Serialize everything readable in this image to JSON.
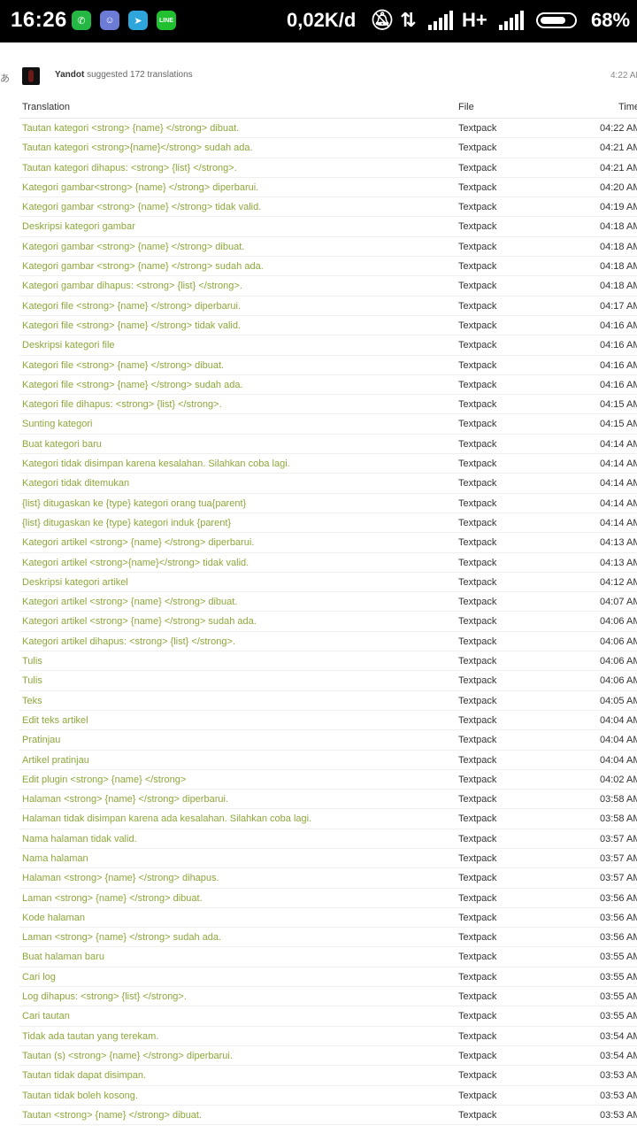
{
  "status_bar": {
    "time": "16:26",
    "apps": [
      "whatsapp-icon",
      "discord-icon",
      "telegram-icon",
      "line-icon"
    ],
    "net_speed": "0,02K/d",
    "network": "H+",
    "battery": "68%"
  },
  "activity": {
    "lang_glyph": "あ",
    "user": "Yandot",
    "action": " suggested 172 translations",
    "time": "4:22 AM"
  },
  "table": {
    "headers": {
      "translation": "Translation",
      "file": "File",
      "time": "Time"
    },
    "rows": [
      {
        "t": "Tautan kategori <strong> {name} </strong> dibuat.",
        "f": "Textpack",
        "time": "04:22 AM"
      },
      {
        "t": "Tautan kategori <strong>{name}</strong> sudah ada.",
        "f": "Textpack",
        "time": "04:21 AM"
      },
      {
        "t": "Tautan kategori dihapus: <strong> {list} </strong>.",
        "f": "Textpack",
        "time": "04:21 AM"
      },
      {
        "t": "Kategori gambar<strong> {name} </strong> diperbarui.",
        "f": "Textpack",
        "time": "04:20 AM"
      },
      {
        "t": "Kategori gambar <strong> {name} </strong> tidak valid.",
        "f": "Textpack",
        "time": "04:19 AM"
      },
      {
        "t": "Deskripsi kategori gambar",
        "f": "Textpack",
        "time": "04:18 AM"
      },
      {
        "t": "Kategori gambar <strong> {name} </strong> dibuat.",
        "f": "Textpack",
        "time": "04:18 AM"
      },
      {
        "t": "Kategori gambar <strong> {name} </strong> sudah ada.",
        "f": "Textpack",
        "time": "04:18 AM"
      },
      {
        "t": "Kategori gambar dihapus: <strong> {list} </strong>.",
        "f": "Textpack",
        "time": "04:18 AM"
      },
      {
        "t": "Kategori file <strong> {name} </strong> diperbarui.",
        "f": "Textpack",
        "time": "04:17 AM"
      },
      {
        "t": "Kategori file <strong> {name} </strong> tidak valid.",
        "f": "Textpack",
        "time": "04:16 AM"
      },
      {
        "t": "Deskripsi kategori file",
        "f": "Textpack",
        "time": "04:16 AM"
      },
      {
        "t": "Kategori file <strong> {name} </strong> dibuat.",
        "f": "Textpack",
        "time": "04:16 AM"
      },
      {
        "t": "Kategori file <strong> {name} </strong> sudah ada.",
        "f": "Textpack",
        "time": "04:16 AM"
      },
      {
        "t": "Kategori file dihapus: <strong> {list} </strong>.",
        "f": "Textpack",
        "time": "04:15 AM"
      },
      {
        "t": "Sunting kategori",
        "f": "Textpack",
        "time": "04:15 AM"
      },
      {
        "t": "Buat kategori baru",
        "f": "Textpack",
        "time": "04:14 AM"
      },
      {
        "t": "Kategori tidak disimpan karena kesalahan. Silahkan coba lagi.",
        "f": "Textpack",
        "time": "04:14 AM"
      },
      {
        "t": "Kategori tidak ditemukan",
        "f": "Textpack",
        "time": "04:14 AM"
      },
      {
        "t": "{list} ditugaskan ke {type} kategori orang tua{parent}",
        "f": "Textpack",
        "time": "04:14 AM"
      },
      {
        "t": "{list} ditugaskan ke {type} kategori induk {parent}",
        "f": "Textpack",
        "time": "04:14 AM"
      },
      {
        "t": "Kategori artikel <strong> {name} </strong> diperbarui.",
        "f": "Textpack",
        "time": "04:13 AM"
      },
      {
        "t": "Kategori artikel <strong>{name}</strong> tidak valid.",
        "f": "Textpack",
        "time": "04:13 AM"
      },
      {
        "t": "Deskripsi kategori artikel",
        "f": "Textpack",
        "time": "04:12 AM"
      },
      {
        "t": "Kategori artikel <strong> {name} </strong> dibuat.",
        "f": "Textpack",
        "time": "04:07 AM"
      },
      {
        "t": "Kategori artikel <strong> {name} </strong> sudah ada.",
        "f": "Textpack",
        "time": "04:06 AM"
      },
      {
        "t": "Kategori artikel dihapus: <strong> {list} </strong>.",
        "f": "Textpack",
        "time": "04:06 AM"
      },
      {
        "t": "Tulis",
        "f": "Textpack",
        "time": "04:06 AM"
      },
      {
        "t": "Tulis",
        "f": "Textpack",
        "time": "04:06 AM"
      },
      {
        "t": "Teks",
        "f": "Textpack",
        "time": "04:05 AM"
      },
      {
        "t": "Edit teks artikel",
        "f": "Textpack",
        "time": "04:04 AM"
      },
      {
        "t": "Pratinjau",
        "f": "Textpack",
        "time": "04:04 AM"
      },
      {
        "t": "Artikel pratinjau",
        "f": "Textpack",
        "time": "04:04 AM"
      },
      {
        "t": "Edit plugin <strong> {name} </strong>",
        "f": "Textpack",
        "time": "04:02 AM"
      },
      {
        "t": "Halaman <strong> {name} </strong> diperbarui.",
        "f": "Textpack",
        "time": "03:58 AM"
      },
      {
        "t": "Halaman tidak disimpan karena ada kesalahan. Silahkan coba lagi.",
        "f": "Textpack",
        "time": "03:58 AM"
      },
      {
        "t": "Nama halaman tidak valid.",
        "f": "Textpack",
        "time": "03:57 AM"
      },
      {
        "t": "Nama halaman",
        "f": "Textpack",
        "time": "03:57 AM"
      },
      {
        "t": "Halaman <strong> {name} </strong> dihapus.",
        "f": "Textpack",
        "time": "03:57 AM"
      },
      {
        "t": "Laman <strong> {name} </strong> dibuat.",
        "f": "Textpack",
        "time": "03:56 AM"
      },
      {
        "t": "Kode halaman",
        "f": "Textpack",
        "time": "03:56 AM"
      },
      {
        "t": "Laman <strong> {name} </strong> sudah ada.",
        "f": "Textpack",
        "time": "03:56 AM"
      },
      {
        "t": "Buat halaman baru",
        "f": "Textpack",
        "time": "03:55 AM"
      },
      {
        "t": "Cari log",
        "f": "Textpack",
        "time": "03:55 AM"
      },
      {
        "t": "Log dihapus: <strong> {list} </strong>.",
        "f": "Textpack",
        "time": "03:55 AM"
      },
      {
        "t": "Cari tautan",
        "f": "Textpack",
        "time": "03:55 AM"
      },
      {
        "t": "Tidak ada tautan yang terekam.",
        "f": "Textpack",
        "time": "03:54 AM"
      },
      {
        "t": "Tautan (s) <strong> {name} </strong> diperbarui.",
        "f": "Textpack",
        "time": "03:54 AM"
      },
      {
        "t": "Tautan tidak dapat disimpan.",
        "f": "Textpack",
        "time": "03:53 AM"
      },
      {
        "t": "Tautan tidak boleh kosong.",
        "f": "Textpack",
        "time": "03:53 AM"
      },
      {
        "t": "Tautan <strong> {name} </strong> dibuat.",
        "f": "Textpack",
        "time": "03:53 AM"
      }
    ]
  }
}
